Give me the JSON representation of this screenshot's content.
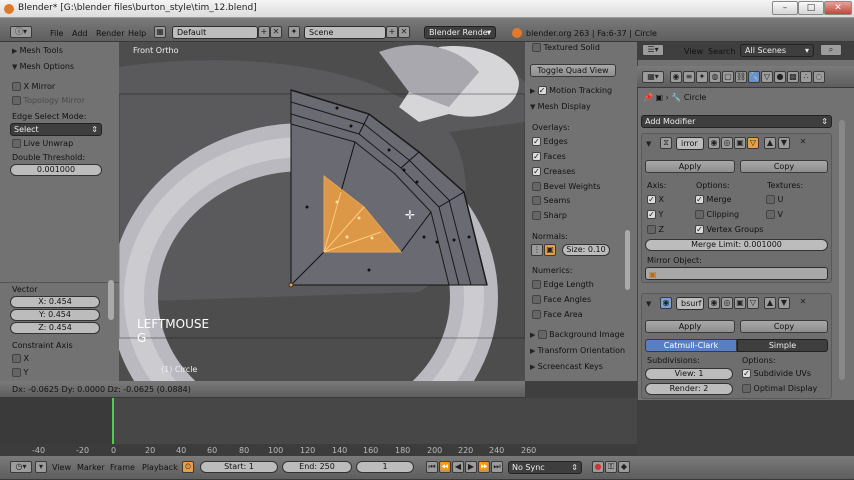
{
  "window": {
    "title": "Blender* [G:\\blender files\\burton_style\\tim_12.blend]",
    "minimize": "–",
    "maximize": "□",
    "close": "✕"
  },
  "info_header": {
    "menus": [
      "File",
      "Add",
      "Render",
      "Help"
    ],
    "layout": "Default",
    "scene": "Scene",
    "engine": "Blender Render",
    "stats": "blender.org 263 | Fa:6-37 | Circle"
  },
  "right_header": {
    "menus": [
      "View",
      "Search"
    ],
    "scenes": "All Scenes"
  },
  "toolshelf": {
    "mesh_tools": "Mesh Tools",
    "mesh_options": "Mesh Options",
    "x_mirror": "X Mirror",
    "topology_mirror": "Topology Mirror",
    "edge_select_mode_label": "Edge Select Mode:",
    "edge_select_mode": "Select",
    "live_unwrap": "Live Unwrap",
    "double_threshold_label": "Double Threshold:",
    "double_threshold": "0.001000"
  },
  "operator": {
    "vector_label": "Vector",
    "x": "X: 0.454",
    "y": "Y: 0.454",
    "z": "Z: 0.454",
    "constraint_axis_label": "Constraint Axis",
    "cx": "X",
    "cy": "Y"
  },
  "viewport": {
    "view_name": "Front Ortho",
    "key_last": "LEFTMOUSE",
    "key_current": "G",
    "object_label": "(1) Circle",
    "status": "Dx: -0.0625  Dy: 0.0000  Dz: -0.0625 (0.0884)",
    "colors": {
      "selection": "#f0a040",
      "background": "#4d4d4d",
      "mesh": "#c8c8cc"
    }
  },
  "npanel": {
    "textured_solid": "Textured Solid",
    "toggle_quad_view": "Toggle Quad View",
    "motion_tracking": "Motion Tracking",
    "mesh_display": "Mesh Display",
    "overlays_label": "Overlays:",
    "overlays": [
      {
        "label": "Edges",
        "on": true
      },
      {
        "label": "Faces",
        "on": true
      },
      {
        "label": "Creases",
        "on": true
      },
      {
        "label": "Bevel Weights",
        "on": false
      },
      {
        "label": "Seams",
        "on": false
      },
      {
        "label": "Sharp",
        "on": false
      }
    ],
    "normals_label": "Normals:",
    "normal_size": "Size: 0.10",
    "numerics_label": "Numerics:",
    "numerics": [
      "Edge Length",
      "Face Angles",
      "Face Area"
    ],
    "background_image": "Background Image",
    "transform_orientation": "Transform Orientation",
    "screencast_keys": "Screencast Keys"
  },
  "properties": {
    "object_name": "Circle",
    "add_modifier": "Add Modifier",
    "mirror": {
      "name": "irror",
      "apply": "Apply",
      "copy": "Copy",
      "axis_label": "Axis:",
      "options_label": "Options:",
      "textures_label": "Textures:",
      "axes": [
        {
          "label": "X",
          "on": true
        },
        {
          "label": "Y",
          "on": true
        },
        {
          "label": "Z",
          "on": false
        }
      ],
      "options": [
        {
          "label": "Merge",
          "on": true
        },
        {
          "label": "Clipping",
          "on": false
        },
        {
          "label": "Vertex Groups",
          "on": true
        }
      ],
      "textures": [
        {
          "label": "U",
          "on": false
        },
        {
          "label": "V",
          "on": false
        }
      ],
      "merge_limit": "Merge Limit: 0.001000",
      "mirror_object_label": "Mirror Object:"
    },
    "subsurf": {
      "name": "bsurf",
      "apply": "Apply",
      "copy": "Copy",
      "catmull_clark": "Catmull-Clark",
      "simple": "Simple",
      "subdivisions_label": "Subdivisions:",
      "options_label": "Options:",
      "view": "View: 1",
      "render": "Render: 2",
      "subdivide_uvs": "Subdivide UVs",
      "optimal_display": "Optimal Display"
    }
  },
  "timeline": {
    "ticks": [
      "-40",
      "-20",
      "0",
      "20",
      "40",
      "60",
      "80",
      "100",
      "120",
      "140",
      "160",
      "180",
      "200",
      "220",
      "240",
      "260"
    ],
    "menus": [
      "View",
      "Marker",
      "Frame",
      "Playback"
    ],
    "start": "Start: 1",
    "end": "End: 250",
    "current": "1",
    "sync": "No Sync",
    "current_frame_color": "#4cd04c"
  }
}
